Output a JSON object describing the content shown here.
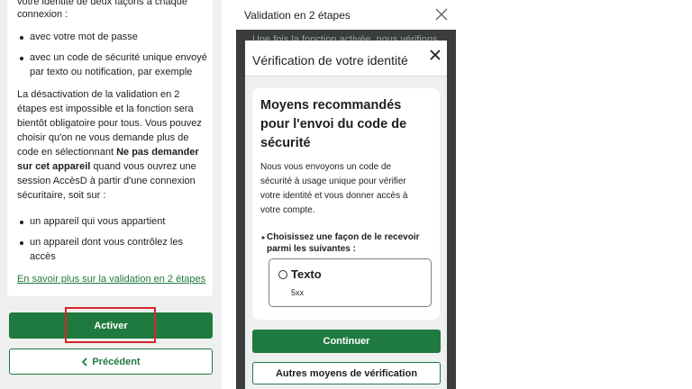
{
  "left": {
    "intro_line1": "votre identité de deux façons à chaque",
    "intro_line2": "connexion :",
    "methods": [
      [
        "avec votre mot de passe"
      ],
      [
        "avec un code de sécurité unique envoyé",
        "par texto ou notification, par exemple"
      ]
    ],
    "para": [
      "La désactivation de la validation en 2",
      "étapes est impossible et la fonction sera",
      "bientôt obligatoire pour tous. Vous pouvez",
      "choisir qu'on ne vous demande plus de"
    ],
    "para_line5_prefix": "code en sélectionnant ",
    "para_line5_bold": "Ne pas demander",
    "para_line6_bold": "sur cet appareil",
    "para_line6_suffix": " quand vous ouvrez une",
    "para_tail": [
      "session AccèsD à partir d'une connexion",
      "sécuritaire, soit sur :"
    ],
    "devices": [
      [
        "un appareil qui vous appartient"
      ],
      [
        "un appareil dont vous contrôlez les",
        "accès"
      ]
    ],
    "learn_more_link": "En savoir plus sur la validation en 2 étapes",
    "activate_label": "Activer",
    "previous_label": "Précédent"
  },
  "right": {
    "header_title": "Validation en 2 étapes",
    "background_text": "Une fois la fonction activée, nous vérifions",
    "modal": {
      "title": "Vérification de votre identité",
      "heading": [
        "Moyens recommandés",
        "pour l'envoi du code de",
        "sécurité"
      ],
      "body": [
        "Nous vous envoyons un code de",
        "sécurité à usage unique pour vérifier",
        "votre identité et vous donner accès à",
        "votre compte."
      ],
      "required_mark": "*",
      "question": [
        "Choisissez une façon de le recevoir",
        "parmi les suivantes :"
      ],
      "option": {
        "label": "Texto",
        "sub": "5xx"
      },
      "continue_label": "Continuer",
      "other_label": "Autres moyens de vérification"
    }
  },
  "colors": {
    "accent": "#1f7a3f",
    "highlight": "#d8262b",
    "overlay": "#3b3d3d"
  },
  "icons": [
    "close-icon",
    "chevron-left-icon"
  ]
}
